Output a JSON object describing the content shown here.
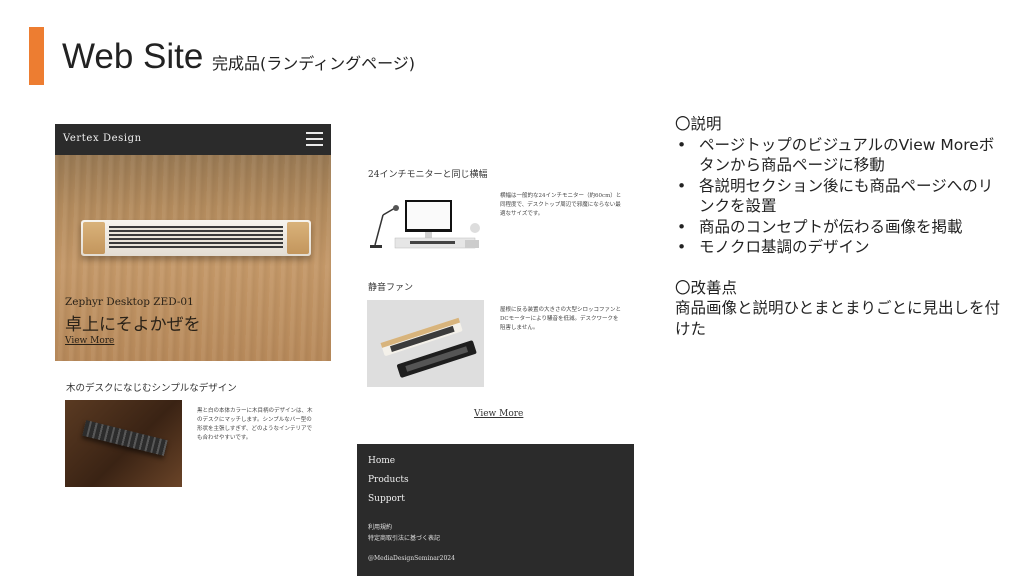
{
  "colors": {
    "accent": "#ed7d31",
    "dark": "#2b2b2b"
  },
  "slide": {
    "title": "Web Site",
    "subtitle": "完成品(ランディングページ)"
  },
  "mock_left": {
    "brand": "Vertex Design",
    "menu_icon": "hamburger-menu-icon",
    "product_name": "Zephyr Desktop ZED-01",
    "catchcopy": "卓上にそよかぜを",
    "view_more": "View More",
    "section1": {
      "heading": "木のデスクになじむシンプルなデザイン",
      "text": "黒と白の本体カラーに木目柄のデザインは、木のデスクにマッチします。シンプルなバー型の形状を主張しすぎず、どのようなインテリアでも合わせやすいです。"
    }
  },
  "mock_right": {
    "section2": {
      "heading": "24インチモニターと同じ横幅",
      "text": "横幅は一般的な24インチモニター（約60cm）と同程度で、デスクトップ周辺で邪魔にならない最適なサイズです。"
    },
    "section3": {
      "heading": "静音ファン",
      "text": "屋根に反る装置の大きさの大型シロッコファンとDCモーターにより騒音を低減。デスクワークを阻害しません。"
    },
    "view_more": "View More",
    "footer": {
      "nav": [
        "Home",
        "Products",
        "Support"
      ],
      "terms": "利用規約",
      "law": "特定商取引法に基づく表記",
      "copyright": "@MediaDesignSeminar2024"
    }
  },
  "notes": {
    "explanation_heading": "〇説明",
    "explanation_items": [
      "ページトップのビジュアルのView Moreボタンから商品ページに移動",
      "各説明セクション後にも商品ページへのリンクを設置",
      "商品のコンセプトが伝わる画像を掲載",
      "モノクロ基調のデザイン"
    ],
    "improvement_heading": "〇改善点",
    "improvement_text": "商品画像と説明ひとまとまりごとに見出しを付けた"
  }
}
